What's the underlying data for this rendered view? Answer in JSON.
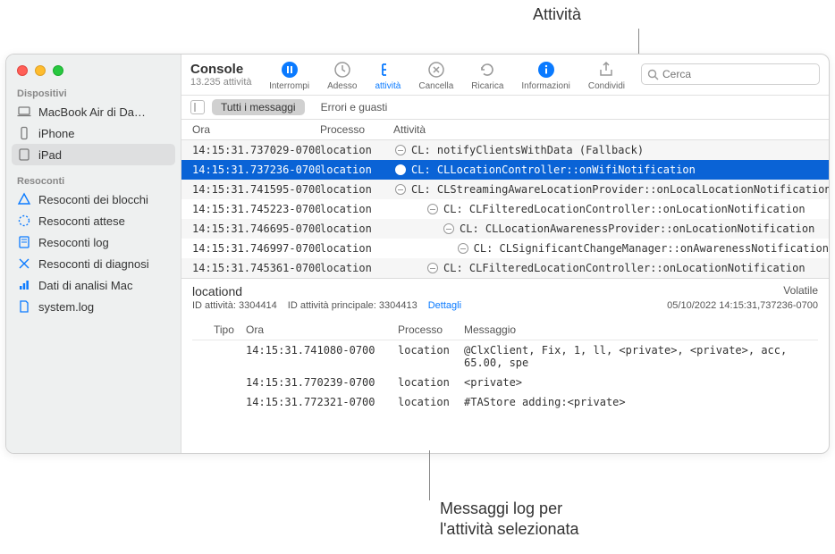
{
  "callouts": {
    "top": "Attività",
    "bottom_line1": "Messaggi log per",
    "bottom_line2": "l'attività selezionata"
  },
  "toolbar": {
    "title": "Console",
    "subtitle": "13.235 attività",
    "interrompi": "Interrompi",
    "adesso": "Adesso",
    "attivita": "attività",
    "cancella": "Cancella",
    "ricarica": "Ricarica",
    "informazioni": "Informazioni",
    "condividi": "Condividi",
    "search_placeholder": "Cerca"
  },
  "filters": {
    "tutti": "Tutti i messaggi",
    "errori": "Errori e guasti"
  },
  "sidebar": {
    "sec1": "Dispositivi",
    "dev0": "MacBook Air di Da…",
    "dev1": "iPhone",
    "dev2": "iPad",
    "sec2": "Resoconti",
    "r0": "Resoconti dei blocchi",
    "r1": "Resoconti attese",
    "r2": "Resoconti log",
    "r3": "Resoconti di diagnosi",
    "r4": "Dati di analisi Mac",
    "r5": "system.log"
  },
  "columns": {
    "ora": "Ora",
    "processo": "Processo",
    "attivita": "Attività"
  },
  "rows": [
    {
      "time": "14:15:31.737029-0700",
      "proc": "location",
      "indent": 0,
      "msg": "CL: notifyClientsWithData (Fallback)",
      "sel": false
    },
    {
      "time": "14:15:31.737236-0700",
      "proc": "location",
      "indent": 0,
      "msg": "CL: CLLocationController::onWifiNotification",
      "sel": true
    },
    {
      "time": "14:15:31.741595-0700",
      "proc": "location",
      "indent": 1,
      "msg": "CL: CLStreamingAwareLocationProvider::onLocalLocationNotification",
      "sel": false
    },
    {
      "time": "14:15:31.745223-0700",
      "proc": "location",
      "indent": 2,
      "msg": "CL: CLFilteredLocationController::onLocationNotification",
      "sel": false
    },
    {
      "time": "14:15:31.746695-0700",
      "proc": "location",
      "indent": 3,
      "msg": "CL: CLLocationAwarenessProvider::onLocationNotification",
      "sel": false
    },
    {
      "time": "14:15:31.746997-0700",
      "proc": "location",
      "indent": 4,
      "msg": "CL: CLSignificantChangeManager::onAwarenessNotification",
      "sel": false
    },
    {
      "time": "14:15:31.745361-0700",
      "proc": "location",
      "indent": 2,
      "msg": "CL: CLFilteredLocationController::onLocationNotification",
      "sel": false
    }
  ],
  "detail": {
    "title": "locationd",
    "volatile": "Volatile",
    "id_attivita_label": "ID attività: ",
    "id_attivita_val": "3304414",
    "id_principale_label": "ID attività principale: ",
    "id_principale_val": "3304413",
    "dettagli": "Dettagli",
    "date": "05/10/2022 14:15:31,737236-0700",
    "cols": {
      "tipo": "Tipo",
      "ora": "Ora",
      "processo": "Processo",
      "messaggio": "Messaggio"
    },
    "rows": [
      {
        "time": "14:15:31.741080-0700",
        "proc": "location",
        "msg": "@ClxClient, Fix, 1, ll, <private>, <private>, acc, 65.00, spe"
      },
      {
        "time": "14:15:31.770239-0700",
        "proc": "location",
        "msg": "<private>"
      },
      {
        "time": "14:15:31.772321-0700",
        "proc": "location",
        "msg": "#TAStore adding:<private>"
      }
    ]
  }
}
